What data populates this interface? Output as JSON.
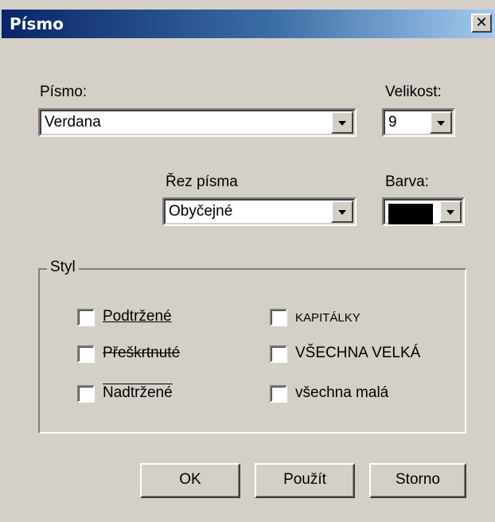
{
  "window": {
    "title": "Písmo",
    "close_glyph": "✕"
  },
  "font": {
    "label": "Písmo:",
    "value": "Verdana"
  },
  "size": {
    "label": "Velikost:",
    "value": "9"
  },
  "style_select": {
    "label": "Řez písma",
    "value": "Obyčejné"
  },
  "color": {
    "label": "Barva:",
    "value": "#000000"
  },
  "styl_group": {
    "title": "Styl",
    "options": [
      {
        "label": "Podtržené",
        "checked": false
      },
      {
        "label": "Přeškrtnuté",
        "checked": false
      },
      {
        "label": "Nadtržené",
        "checked": false
      },
      {
        "label": "KAPITÁLKY",
        "checked": false
      },
      {
        "label": "VŠECHNA VELKÁ",
        "checked": false
      },
      {
        "label": "všechna malá",
        "checked": false
      }
    ]
  },
  "buttons": {
    "ok": "OK",
    "apply": "Použít",
    "cancel": "Storno"
  }
}
